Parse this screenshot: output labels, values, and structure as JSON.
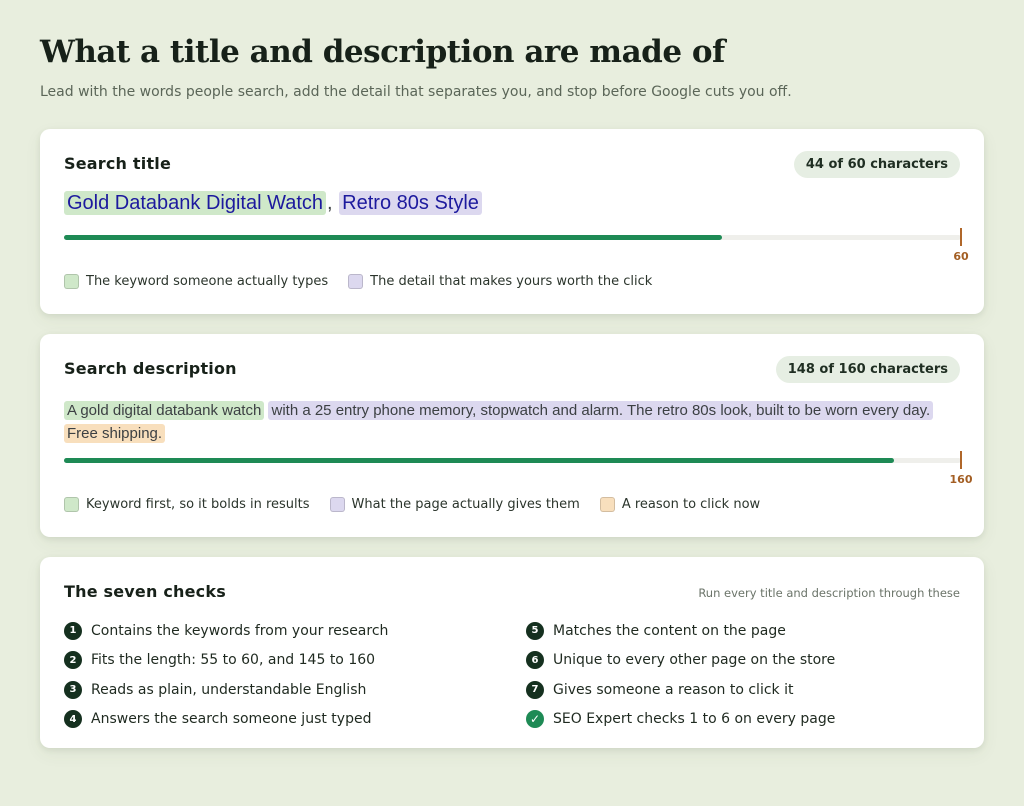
{
  "header": {
    "title": "What a title and description are made of",
    "subtitle": "Lead with the words people search, add the detail that separates you, and stop before Google cuts you off."
  },
  "colors": {
    "keyword": "#cfe8c9",
    "detail": "#dcd8ef",
    "reason": "#f8dfbd",
    "progress": "#1e8a55",
    "limit": "#b0672a"
  },
  "title_card": {
    "heading": "Search title",
    "count": "44 of 60 characters",
    "used": 44,
    "limit": 60,
    "limit_label": "60",
    "serp_keyword": "Gold Databank Digital Watch",
    "serp_separator": ",",
    "serp_detail": "Retro 80s Style",
    "legend": [
      {
        "label": "The keyword someone actually types",
        "color": "#cfe8c9"
      },
      {
        "label": "The detail that makes yours worth the click",
        "color": "#dcd8ef"
      }
    ]
  },
  "desc_card": {
    "heading": "Search description",
    "count": "148 of 160 characters",
    "used": 148,
    "limit": 160,
    "limit_label": "160",
    "serp_keyword": "A gold digital databank watch",
    "serp_detail": "with a 25 entry phone memory, stopwatch and alarm. The retro 80s look, built to be worn every day.",
    "serp_reason": "Free shipping.",
    "legend": [
      {
        "label": "Keyword first, so it bolds in results",
        "color": "#cfe8c9"
      },
      {
        "label": "What the page actually gives them",
        "color": "#dcd8ef"
      },
      {
        "label": "A reason to click now",
        "color": "#f8dfbd"
      }
    ]
  },
  "checks_card": {
    "heading": "The seven checks",
    "note": "Run every title and description through these",
    "left": [
      {
        "num": "1",
        "text": "Contains the keywords from your research"
      },
      {
        "num": "2",
        "text": "Fits the length: 55 to 60, and 145 to 160"
      },
      {
        "num": "3",
        "text": "Reads as plain, understandable English"
      },
      {
        "num": "4",
        "text": "Answers the search someone just typed"
      }
    ],
    "right": [
      {
        "num": "5",
        "text": "Matches the content on the page"
      },
      {
        "num": "6",
        "text": "Unique to every other page on the store"
      },
      {
        "num": "7",
        "text": "Gives someone a reason to click it"
      },
      {
        "num": "✓",
        "text": "SEO Expert checks 1 to 6 on every page"
      }
    ]
  }
}
